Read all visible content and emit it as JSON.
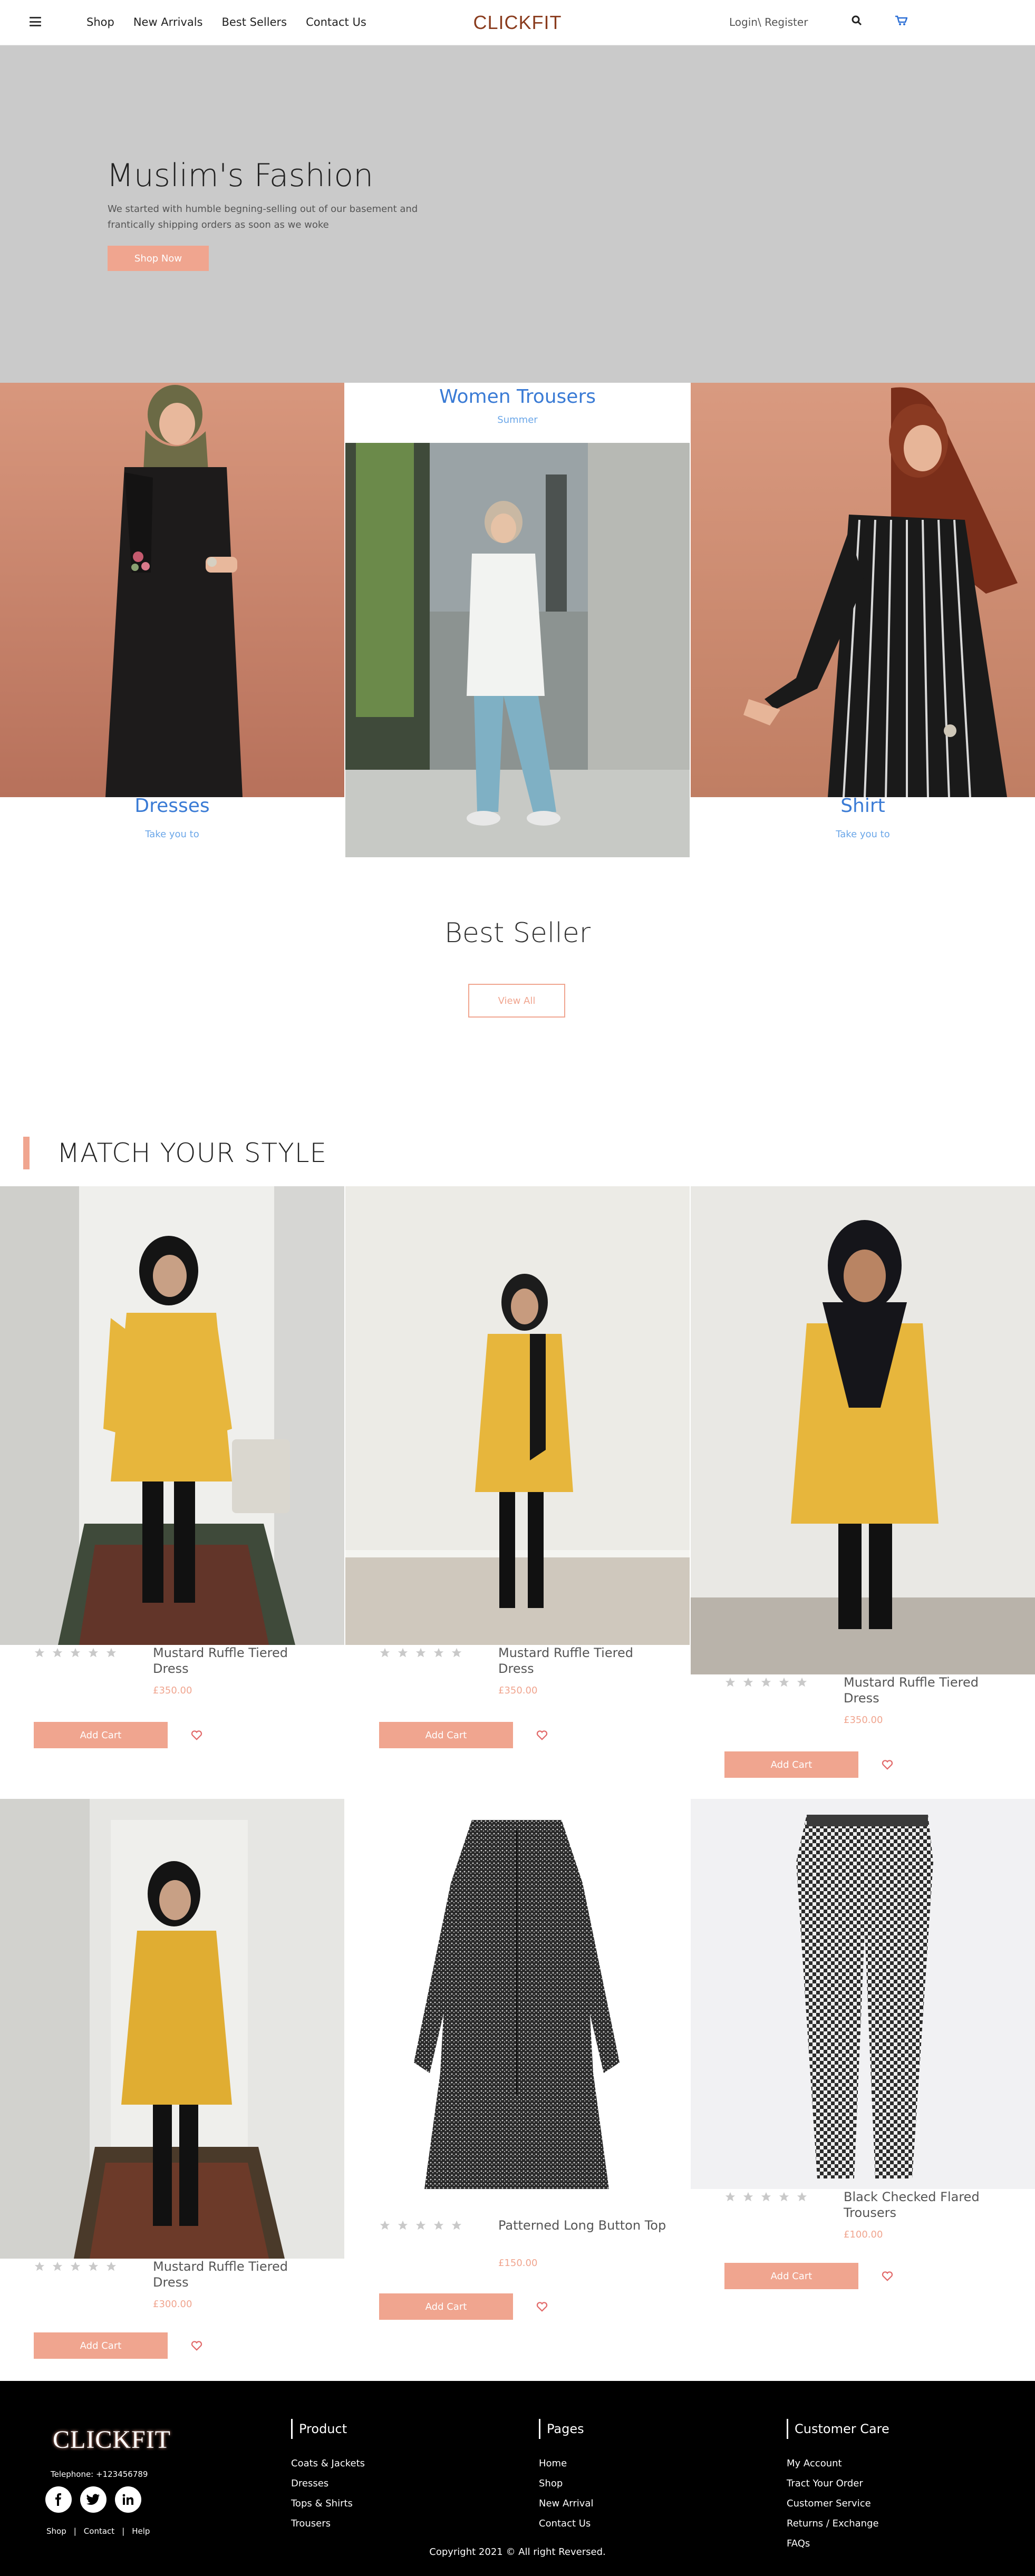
{
  "header": {
    "nav": [
      "Shop",
      "New Arrivals",
      "Best Sellers",
      "Contact Us"
    ],
    "logo": "CLICKFIT",
    "login": "Login",
    "separator": "\\",
    "register": "Register",
    "icons": [
      "menu-icon",
      "search-icon",
      "cart-icon"
    ]
  },
  "hero": {
    "title": "Muslim's Fashion",
    "text": "We started with humble begning-selling out of our basement and frantically shipping orders as soon as we woke",
    "button": "Shop Now"
  },
  "categories": [
    {
      "title": "Dresses",
      "subtitle": "Take you to"
    },
    {
      "title": "Women Trousers",
      "subtitle": "Summer"
    },
    {
      "title": "Shirt",
      "subtitle": "Take you to"
    }
  ],
  "best_seller": {
    "title": "Best Seller",
    "button": "View All"
  },
  "match_your_style": {
    "title": "MATCH YOUR STYLE",
    "products": [
      {
        "name": "Mustard Ruffle Tiered Dress",
        "price": "£350.00",
        "button": "Add Cart",
        "rating": 0
      },
      {
        "name": "Mustard Ruffle Tiered Dress",
        "price": "£350.00",
        "button": "Add Cart",
        "rating": 0
      },
      {
        "name": "Mustard Ruffle Tiered Dress",
        "price": "£350.00",
        "button": "Add Cart",
        "rating": 0
      },
      {
        "name": "Mustard Ruffle Tiered Dress",
        "price": "£300.00",
        "button": "Add Cart",
        "rating": 0
      },
      {
        "name": "Patterned Long Button Top",
        "price": "£150.00",
        "button": "Add Cart",
        "rating": 0
      },
      {
        "name": "Black Checked Flared Trousers",
        "price": "£100.00",
        "button": "Add Cart",
        "rating": 0
      }
    ]
  },
  "footer": {
    "logo": "CLICKFIT",
    "phone": "Telephone: +123456789",
    "social": [
      "facebook-icon",
      "twitter-icon",
      "linkedin-icon"
    ],
    "links": [
      "Shop",
      "|",
      "Contact",
      "|",
      "Help"
    ],
    "columns": [
      {
        "title": "Product",
        "items": [
          "Coats & Jackets",
          "Dresses",
          "Tops & Shirts",
          "Trousers"
        ]
      },
      {
        "title": "Pages",
        "items": [
          "Home",
          "Shop",
          "New Arrival",
          "Contact Us"
        ]
      },
      {
        "title": "Customer Care",
        "items": [
          "My Account",
          "Tract Your Order",
          "Customer Service",
          "Returns / Exchange",
          "FAQs"
        ]
      }
    ],
    "copyright": "Copyright 2021 © All right Reversed."
  },
  "colors": {
    "accent": "#f0a58f",
    "logo": "#8a3c1e",
    "category_title": "#3a7bd5",
    "hero_bg": "#cacaca",
    "footer_bg": "#000000"
  }
}
